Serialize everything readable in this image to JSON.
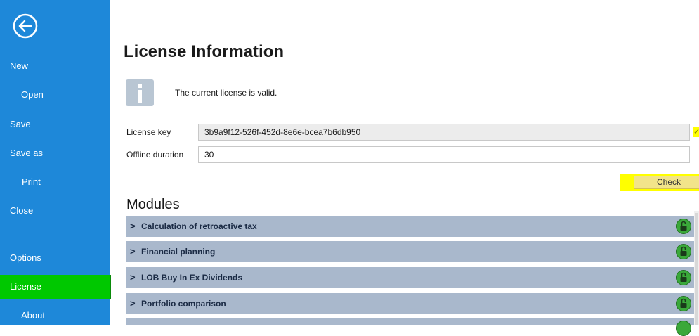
{
  "sidebar": {
    "back_icon": "back-arrow-circle-icon",
    "items": [
      {
        "label": "New"
      },
      {
        "label": "Open"
      },
      {
        "label": "Save"
      },
      {
        "label": "Save as"
      },
      {
        "label": "Print"
      },
      {
        "label": "Close"
      },
      {
        "label": "Options"
      },
      {
        "label": "License"
      },
      {
        "label": "About"
      }
    ],
    "active": "License",
    "colors": {
      "background": "#1e88d9",
      "active": "#00c800"
    }
  },
  "main": {
    "title": "License Information",
    "status_icon": "info-icon",
    "status_text": "The current license is valid.",
    "fields": {
      "license_key": {
        "label": "License key",
        "value": "3b9a9f12-526f-452d-8e6e-bcea7b6db950"
      },
      "offline_duration": {
        "label": "Offline duration",
        "value": "30"
      }
    },
    "check_button": "Check",
    "modules_title": "Modules",
    "modules": [
      {
        "label": "Calculation of retroactive tax",
        "icon": "unlocked-icon"
      },
      {
        "label": "Financial planning",
        "icon": "unlocked-icon"
      },
      {
        "label": "LOB Buy In Ex Dividends",
        "icon": "unlocked-icon"
      },
      {
        "label": "Portfolio comparison",
        "icon": "unlocked-icon"
      }
    ],
    "colors": {
      "module_row": "#a9b8cc",
      "highlight": "#ffff00",
      "lock": "#3aa83a"
    }
  }
}
